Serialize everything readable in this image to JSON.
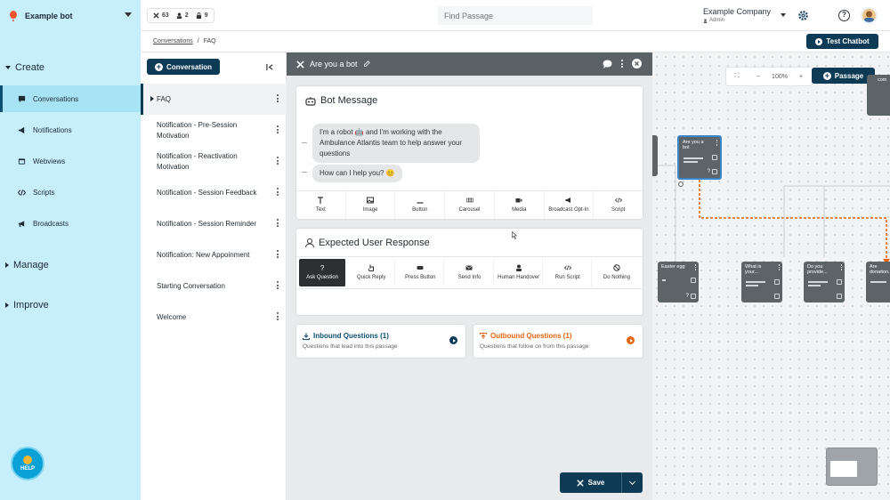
{
  "topbar": {
    "bot_name": "Example bot",
    "stats": {
      "passages": "63",
      "users": "2",
      "locks": "9"
    },
    "find_placeholder": "Find Passage",
    "company": "Example Company",
    "role": "Admin"
  },
  "sidebar": {
    "sections": {
      "create": "Create",
      "manage": "Manage",
      "improve": "Improve"
    },
    "items": [
      {
        "label": "Conversations",
        "icon": "chat-icon"
      },
      {
        "label": "Notifications",
        "icon": "megaphone-icon"
      },
      {
        "label": "Webviews",
        "icon": "window-icon"
      },
      {
        "label": "Scripts",
        "icon": "code-icon"
      },
      {
        "label": "Broadcasts",
        "icon": "broadcast-icon"
      }
    ],
    "help_label": "HELP"
  },
  "breadcrumb": {
    "root": "Conversations",
    "separator": "/",
    "current": "FAQ"
  },
  "test_chatbot": "Test Chatbot",
  "conversations": {
    "new_button": "Conversation",
    "items": [
      "FAQ",
      "Notification - Pre-Session Motivation",
      "Notification - Reactivation Motivation",
      "Notification - Session Feedback",
      "Notification - Session Reminder",
      "Notification: New Appoinment",
      "Starting Conversation",
      "Welcome"
    ]
  },
  "editor": {
    "passage_name": "Are you a bot",
    "bot_message": {
      "title": "Bot Message",
      "bubbles": [
        "I'm a robot 🤖 and I'm working with the Ambulance Atlantis team to help answer your questions",
        "How can I help you? 😊"
      ],
      "tools": [
        "Text",
        "Image",
        "Button",
        "Carousel",
        "Media",
        "Broadcast Opt-In",
        "Script"
      ]
    },
    "user_response": {
      "title": "Expected User Response",
      "tools": [
        "Ask Question",
        "Quick Reply",
        "Press Button",
        "Send Info",
        "Human Handover",
        "Run Script",
        "Do Nothing"
      ]
    },
    "inbound": {
      "title": "Inbound Questions (1)",
      "desc": "Questions that lead into this passage"
    },
    "outbound": {
      "title": "Outbound Questions (1)",
      "desc": "Questions that follow on from this passage"
    },
    "save": "Save"
  },
  "canvas": {
    "zoom": "100%",
    "passage_button": "Passage",
    "nodes": [
      "Are you a bot",
      "Easter egg",
      "What is your...",
      "Do you provide...",
      "Are donation..."
    ],
    "partial_top": "com"
  },
  "colors": {
    "accent": "#0d3b56",
    "sidebar": "#c6eefb",
    "outbound": "#e8650f",
    "inbound": "#0d4e73"
  }
}
